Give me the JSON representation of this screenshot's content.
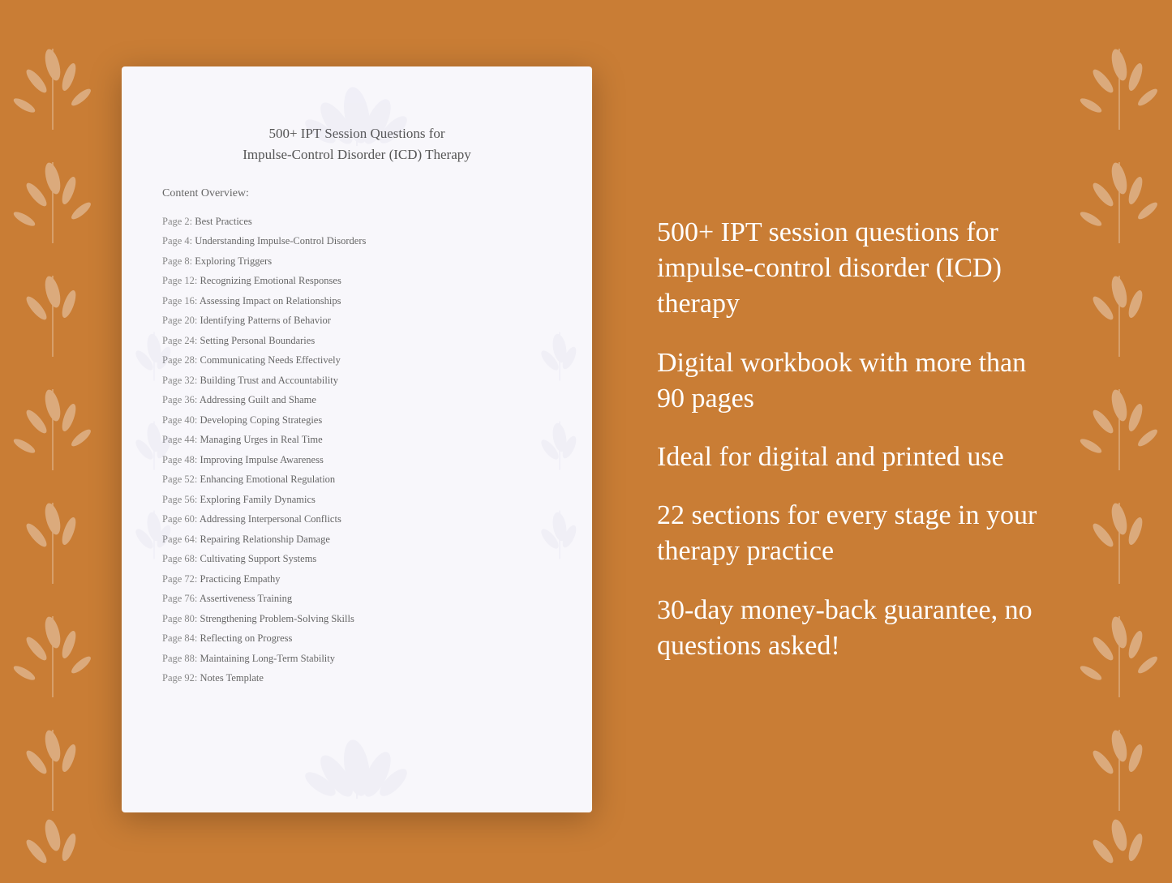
{
  "background_color": "#C97D35",
  "document": {
    "title_line1": "500+ IPT Session Questions for",
    "title_line2": "Impulse-Control Disorder (ICD) Therapy",
    "toc_heading": "Content Overview:",
    "toc_items": [
      {
        "page": "Page  2:",
        "title": "Best Practices"
      },
      {
        "page": "Page  4:",
        "title": "Understanding Impulse-Control Disorders"
      },
      {
        "page": "Page  8:",
        "title": "Exploring Triggers"
      },
      {
        "page": "Page 12:",
        "title": "Recognizing Emotional Responses"
      },
      {
        "page": "Page 16:",
        "title": "Assessing Impact on Relationships"
      },
      {
        "page": "Page 20:",
        "title": "Identifying Patterns of Behavior"
      },
      {
        "page": "Page 24:",
        "title": "Setting Personal Boundaries"
      },
      {
        "page": "Page 28:",
        "title": "Communicating Needs Effectively"
      },
      {
        "page": "Page 32:",
        "title": "Building Trust and Accountability"
      },
      {
        "page": "Page 36:",
        "title": "Addressing Guilt and Shame"
      },
      {
        "page": "Page 40:",
        "title": "Developing Coping Strategies"
      },
      {
        "page": "Page 44:",
        "title": "Managing Urges in Real Time"
      },
      {
        "page": "Page 48:",
        "title": "Improving Impulse Awareness"
      },
      {
        "page": "Page 52:",
        "title": "Enhancing Emotional Regulation"
      },
      {
        "page": "Page 56:",
        "title": "Exploring Family Dynamics"
      },
      {
        "page": "Page 60:",
        "title": "Addressing Interpersonal Conflicts"
      },
      {
        "page": "Page 64:",
        "title": "Repairing Relationship Damage"
      },
      {
        "page": "Page 68:",
        "title": "Cultivating Support Systems"
      },
      {
        "page": "Page 72:",
        "title": "Practicing Empathy"
      },
      {
        "page": "Page 76:",
        "title": "Assertiveness Training"
      },
      {
        "page": "Page 80:",
        "title": "Strengthening Problem-Solving Skills"
      },
      {
        "page": "Page 84:",
        "title": "Reflecting on Progress"
      },
      {
        "page": "Page 88:",
        "title": "Maintaining Long-Term Stability"
      },
      {
        "page": "Page 92:",
        "title": "Notes Template"
      }
    ]
  },
  "features": [
    "500+ IPT session questions for impulse-control disorder (ICD) therapy",
    "Digital workbook with more than 90 pages",
    "Ideal for digital and printed use",
    "22 sections for every stage in your therapy practice",
    "30-day money-back guarantee, no questions asked!"
  ]
}
